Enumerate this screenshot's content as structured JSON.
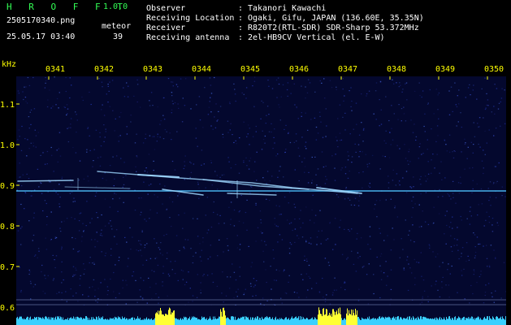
{
  "header": {
    "brand": "H R O F F T",
    "version": "1.0.0",
    "filename": "2505170340.png",
    "timestamp": "25.05.17 03:40",
    "meteor_label": "meteor",
    "meteor_count": "39"
  },
  "info": {
    "rows": [
      {
        "key": "Observer",
        "sep": ":",
        "value": "Takanori Kawachi"
      },
      {
        "key": "Receiving Location",
        "sep": ":",
        "value": "Ogaki, Gifu, JAPAN (136.60E, 35.35N)"
      },
      {
        "key": "Receiver",
        "sep": ":",
        "value": "R820T2(RTL-SDR) SDR-Sharp 53.372MHz"
      },
      {
        "key": "Receiving antenna",
        "sep": ":",
        "value": "2el-HB9CV Vertical (el. E-W)"
      }
    ]
  },
  "axes": {
    "y_unit": "kHz",
    "y_ticks": [
      "1.1",
      "1.0",
      "0.9",
      "0.8",
      "0.7",
      "0.6"
    ],
    "x_ticks": [
      "0341",
      "0342",
      "0343",
      "0344",
      "0345",
      "0346",
      "0347",
      "0348",
      "0349",
      "0350"
    ]
  },
  "colors": {
    "background": "#000000",
    "plot_bg": "#04082e",
    "axis_text": "#ffff00",
    "brand": "#33ff55",
    "echo": "#9fd8ff",
    "carrier": "#4fc3ff",
    "waveform": "#3ad0ff",
    "waveform_peak": "#ffff33"
  }
}
